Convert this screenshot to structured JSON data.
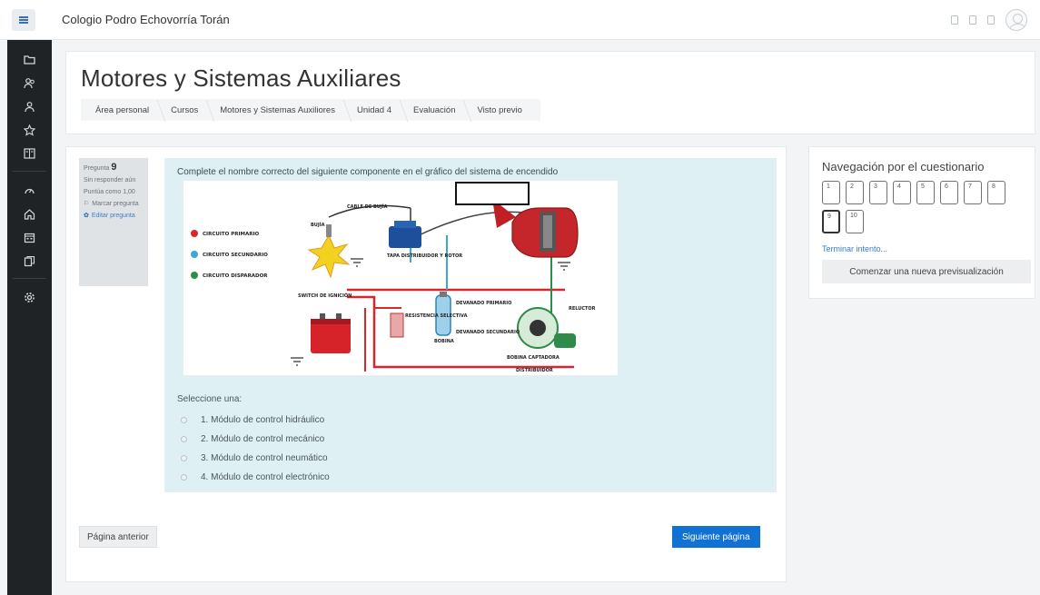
{
  "app": {
    "site_name": "Cologio Podro Echovorría Torán"
  },
  "sidebar": {
    "icons": [
      "folder-icon",
      "users-icon",
      "group-icon",
      "star-icon",
      "book-icon",
      "dashboard-icon",
      "home-icon",
      "calendar-icon",
      "files-icon",
      "settings-icon"
    ]
  },
  "header": {
    "title": "Motores y Sistemas Auxiliares",
    "breadcrumb": [
      "Área personal",
      "Cursos",
      "Motores y Sistemas Auxiliores",
      "Unidad 4",
      "Evaluación",
      "Visto previo"
    ]
  },
  "question": {
    "info": {
      "label": "Pregunta",
      "number": "9",
      "status": "Sin responder aún",
      "score": "Puntúa como 1,00",
      "flag": "Marcar pregunta",
      "edit": "Editar pregunta"
    },
    "text": "Complete el nombre correcto del siguiente componente en el  gráfico del sistema de encendido",
    "diagram": {
      "legend": [
        "CIRCUITO PRIMARIO",
        "CIRCUITO SECUNDARIO",
        "CIRCUITO DISPARADOR"
      ],
      "legend_colors": [
        "#d9262b",
        "#3aa7d6",
        "#2e8b4a"
      ],
      "labels": {
        "cable": "CABLE DE BUJÍA",
        "bujia": "BUJÍA",
        "tapa": "TAPA DISTRIBUIDOR Y ROTOR",
        "switch": "SWITCH DE IGNICIÓN",
        "resistencia": "RESISTENCIA SELECTIVA",
        "primario": "DEVANADO PRIMARIO",
        "secundario": "DEVANADO SECUNDARIO",
        "bobina": "BOBINA",
        "reluctor": "RELUCTOR",
        "captadora": "BOBINA CAPTADORA",
        "distribuidor": "DISTRIBUIDOR"
      }
    },
    "select_label": "Seleccione una:",
    "options": [
      "1. Módulo de control hidráulico",
      "2. Módulo de control mecánico",
      "3. Módulo de control neumático",
      "4. Módulo de control electrónico"
    ]
  },
  "footer_buttons": {
    "prev": "Página anterior",
    "next": "Siguiente página"
  },
  "navigation": {
    "title": "Navegación por el cuestionario",
    "buttons": [
      "1",
      "2",
      "3",
      "4",
      "5",
      "6",
      "7",
      "8",
      "9",
      "10"
    ],
    "current": "9",
    "finish": "Terminar intento...",
    "restart": "Comenzar una nueva previsualización"
  },
  "colors": {
    "accent": "#1172d4",
    "sidebar": "#1f2326",
    "question_bg": "#dff0f4"
  }
}
